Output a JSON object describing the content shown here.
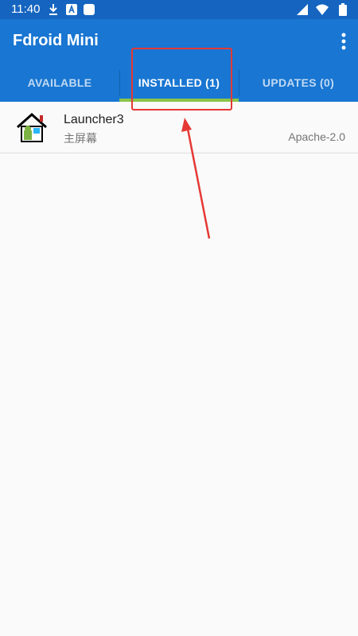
{
  "status_bar": {
    "time": "11:40",
    "icons": [
      "download-icon",
      "a-icon",
      "square-icon",
      "signal-icon",
      "wifi-icon",
      "battery-icon"
    ]
  },
  "app_bar": {
    "title": "Fdroid Mini",
    "menu_icon": "more-vert-icon"
  },
  "tabs": [
    {
      "label": "AVAILABLE",
      "active": false
    },
    {
      "label": "INSTALLED (1)",
      "active": true
    },
    {
      "label": "UPDATES (0)",
      "active": false
    }
  ],
  "apps": [
    {
      "name": "Launcher3",
      "summary": "主屏幕",
      "license": "Apache-2.0",
      "icon": "home-icon"
    }
  ],
  "colors": {
    "status_bar": "#1565c0",
    "app_bar": "#1976d2",
    "tab_indicator": "#8bc34a",
    "annotation": "#e53935"
  }
}
